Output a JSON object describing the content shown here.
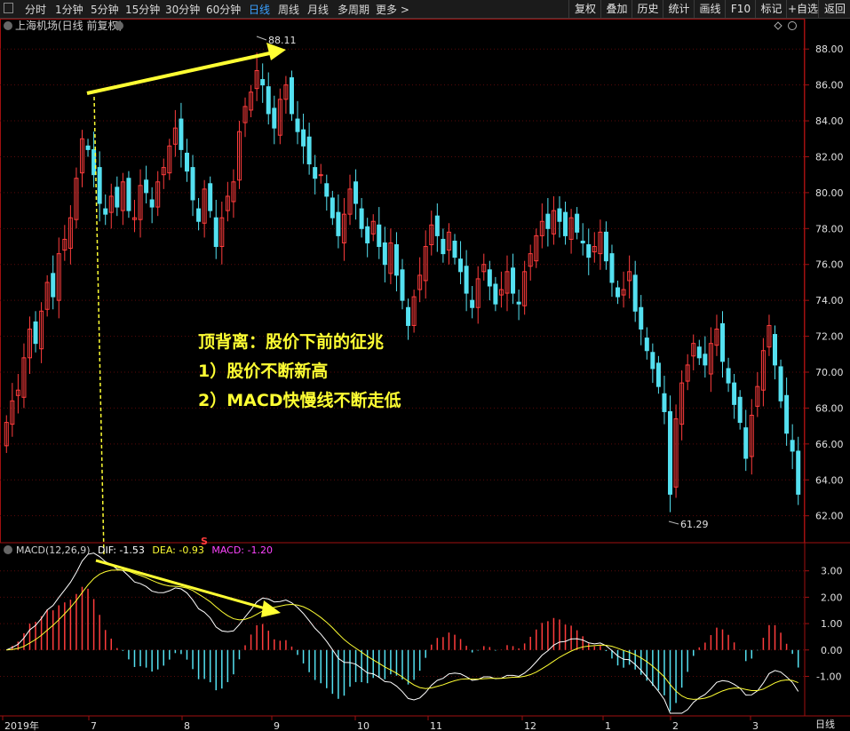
{
  "toolbar": {
    "periods": [
      "分时",
      "1分钟",
      "5分钟",
      "15分钟",
      "30分钟",
      "60分钟",
      "日线",
      "周线",
      "月线",
      "多周期",
      "更多 >"
    ],
    "active_period": "日线",
    "right_buttons": [
      "复权",
      "叠加",
      "历史",
      "统计",
      "画线",
      "F10",
      "标记",
      "+自选",
      "返回"
    ]
  },
  "chart": {
    "title": "上海机场(日线 前复权)",
    "high_label": "88.11",
    "low_label": "61.29",
    "price_ticks": [
      "88.00",
      "86.00",
      "84.00",
      "82.00",
      "80.00",
      "78.00",
      "76.00",
      "74.00",
      "72.00",
      "70.00",
      "68.00",
      "66.00",
      "64.00",
      "62.00"
    ],
    "macd_ticks": [
      "3.00",
      "2.00",
      "1.00",
      "0.00",
      "-1.00"
    ],
    "date_labels": [
      "2019年",
      "7",
      "8",
      "9",
      "10",
      "11",
      "12",
      "1",
      "2",
      "3"
    ],
    "period_label": "日线",
    "s_marker": "S",
    "macd_header": {
      "name": "MACD(12,26,9)",
      "dif": "DIF: -1.53",
      "dea": "DEA: -0.93",
      "macd": "MACD: -1.20"
    },
    "colors": {
      "up": "#ff3c3c",
      "down": "#54e0f0",
      "dif": "#ffffff",
      "dea": "#ffff33",
      "arrow": "#ffff33"
    }
  },
  "annotation": {
    "line1": "顶背离：股价下前的征兆",
    "line2": "1）股价不断新高",
    "line3": "2）MACD快慢线不断走低"
  },
  "chart_data": {
    "type": "candlestick",
    "price_ylim": [
      60.5,
      89
    ],
    "macd_ylim": [
      -2.5,
      4
    ],
    "close": [
      67.2,
      68.4,
      69.0,
      70.8,
      72.4,
      71.6,
      73.4,
      75.0,
      74.2,
      76.6,
      77.4,
      78.6,
      80.8,
      83.0,
      82.4,
      81.0,
      79.4,
      78.8,
      79.8,
      79.2,
      80.6,
      79.0,
      78.6,
      80.4,
      80.0,
      79.2,
      80.6,
      81.4,
      82.6,
      83.6,
      82.4,
      81.2,
      79.6,
      78.4,
      80.2,
      79.0,
      77.0,
      78.6,
      79.8,
      80.6,
      83.4,
      84.8,
      85.6,
      86.8,
      86.0,
      84.4,
      83.6,
      85.2,
      86.0,
      84.4,
      83.4,
      82.6,
      81.6,
      80.8,
      81.0,
      79.8,
      78.6,
      77.6,
      78.8,
      80.2,
      79.4,
      78.0,
      77.2,
      78.4,
      77.0,
      76.0,
      77.2,
      75.4,
      74.0,
      72.6,
      74.2,
      75.4,
      77.0,
      78.2,
      77.6,
      76.6,
      77.8,
      76.4,
      75.6,
      74.4,
      73.6,
      75.2,
      76.0,
      74.8,
      73.8,
      74.6,
      75.6,
      74.4,
      73.8,
      75.6,
      76.6,
      77.6,
      78.4,
      78.0,
      79.0,
      78.4,
      77.6,
      78.6,
      77.8,
      77.2,
      76.4,
      77.0,
      77.8,
      76.2,
      75.0,
      74.2,
      74.6,
      75.6,
      73.4,
      72.4,
      71.2,
      70.2,
      69.2,
      67.8,
      63.2,
      67.4,
      69.4,
      70.4,
      71.6,
      70.8,
      70.4,
      71.6,
      72.4,
      70.6,
      69.4,
      68.2,
      67.2,
      65.2,
      67.6,
      69.2,
      71.2,
      72.6,
      70.4,
      68.4,
      66.6,
      65.6,
      63.2
    ],
    "macd_hist_bars": 150
  }
}
